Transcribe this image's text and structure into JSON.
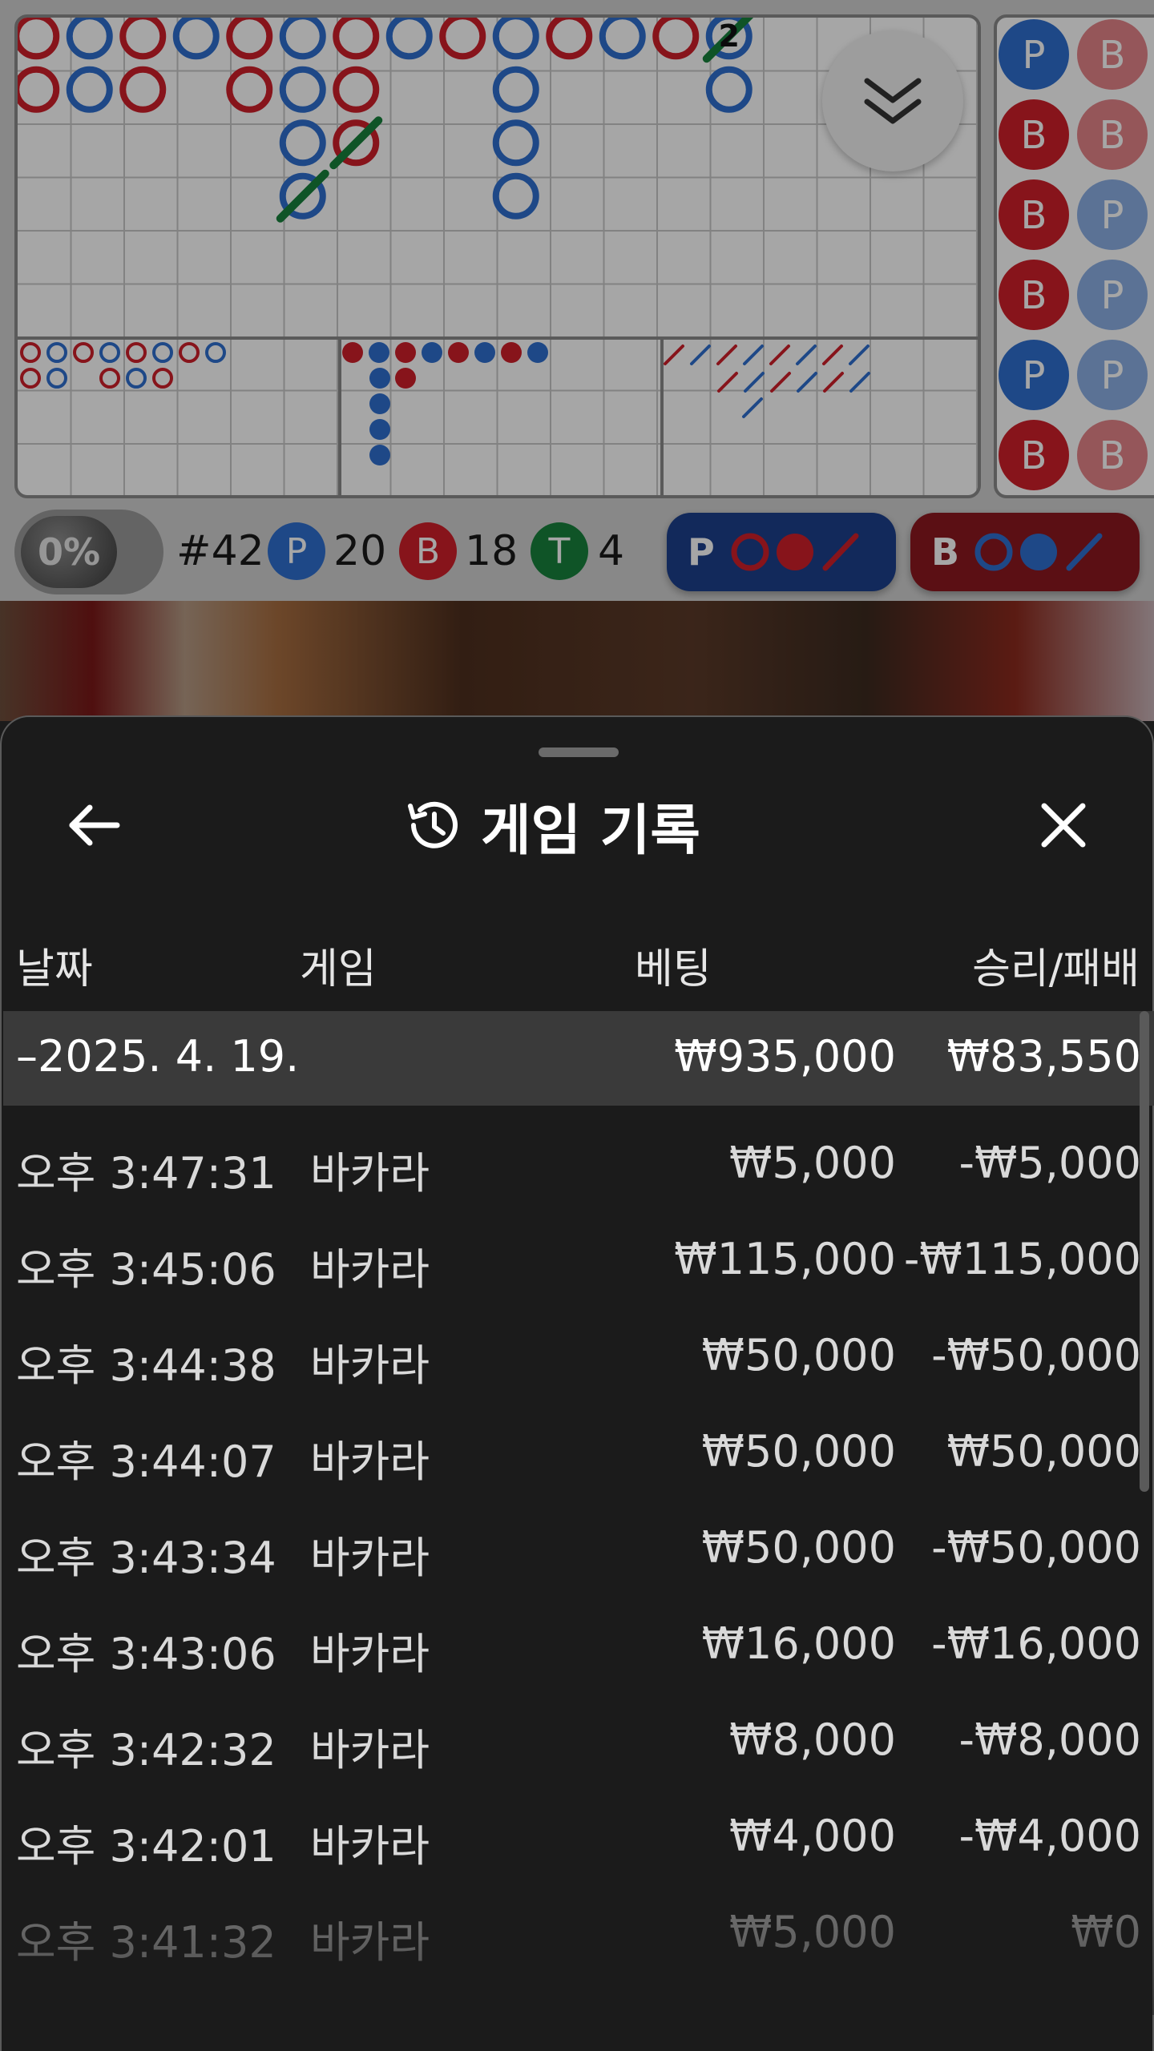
{
  "scoreboard": {
    "percent_label": "0%",
    "round_label": "#42",
    "player_letter": "P",
    "player_count": "20",
    "banker_letter": "B",
    "banker_count": "18",
    "tie_letter": "T",
    "tie_count": "4",
    "predict_player_letter": "P",
    "predict_banker_letter": "B",
    "tie_marker": "2",
    "bead_letters": [
      [
        "P",
        "B"
      ],
      [
        "B",
        "B"
      ],
      [
        "B",
        "P"
      ],
      [
        "B",
        "P"
      ],
      [
        "P",
        "P"
      ],
      [
        "B",
        "B"
      ]
    ],
    "colors": {
      "player": "#2f6fd0",
      "banker": "#d0202a",
      "tie": "#17823c",
      "player_dark": "#1d3f8c",
      "banker_dark": "#8c1820"
    }
  },
  "modal": {
    "title": "게임 기록",
    "icons": {
      "back": "arrow-left-icon",
      "history": "history-clock-icon",
      "close": "close-x-icon",
      "scroll": "chevron-double-down-icon"
    },
    "columns": {
      "date": "날짜",
      "game": "게임",
      "bet": "베팅",
      "result": "승리/패배"
    },
    "group": {
      "date": "–2025. 4. 19.",
      "bet": "₩935,000",
      "result": "₩83,550"
    },
    "rows": [
      {
        "time": "오후 3:47:31",
        "game": "바카라",
        "bet": "₩5,000",
        "result": "-₩5,000"
      },
      {
        "time": "오후 3:45:06",
        "game": "바카라",
        "bet": "₩115,000",
        "result": "-₩115,000"
      },
      {
        "time": "오후 3:44:38",
        "game": "바카라",
        "bet": "₩50,000",
        "result": "-₩50,000"
      },
      {
        "time": "오후 3:44:07",
        "game": "바카라",
        "bet": "₩50,000",
        "result": "₩50,000"
      },
      {
        "time": "오후 3:43:34",
        "game": "바카라",
        "bet": "₩50,000",
        "result": "-₩50,000"
      },
      {
        "time": "오후 3:43:06",
        "game": "바카라",
        "bet": "₩16,000",
        "result": "-₩16,000"
      },
      {
        "time": "오후 3:42:32",
        "game": "바카라",
        "bet": "₩8,000",
        "result": "-₩8,000"
      },
      {
        "time": "오후 3:42:01",
        "game": "바카라",
        "bet": "₩4,000",
        "result": "-₩4,000"
      },
      {
        "time": "오후 3:41:32",
        "game": "바카라",
        "bet": "₩5,000",
        "result": "₩0"
      }
    ]
  }
}
